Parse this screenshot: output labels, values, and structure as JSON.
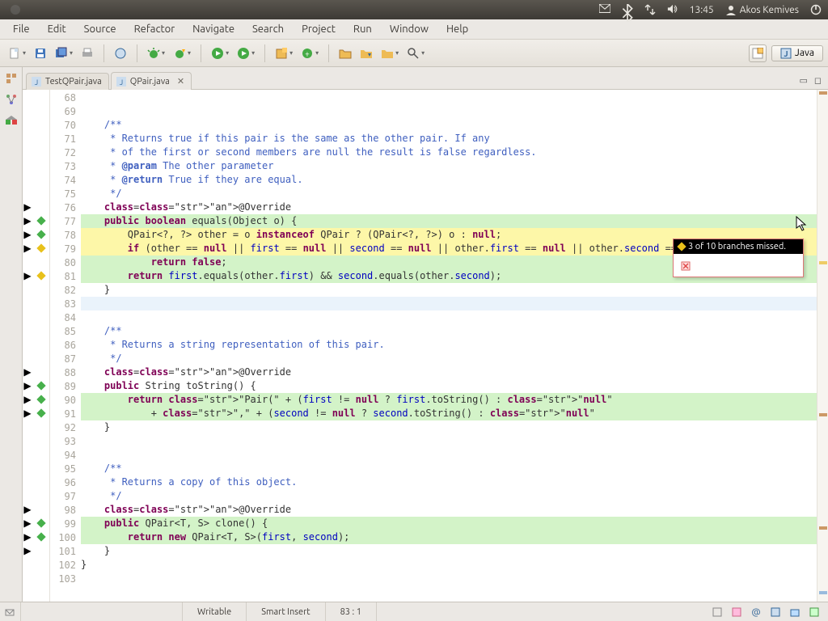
{
  "system": {
    "time": "13:45",
    "user": "Akos Kemives"
  },
  "menu": [
    "File",
    "Edit",
    "Source",
    "Refactor",
    "Navigate",
    "Search",
    "Project",
    "Run",
    "Window",
    "Help"
  ],
  "perspective": {
    "active": "Java"
  },
  "tabs": [
    {
      "label": "TestQPair.java",
      "active": false
    },
    {
      "label": "QPair.java",
      "active": true
    }
  ],
  "coverage_tooltip": "3 of 10 branches missed.",
  "status": {
    "mode": "Writable",
    "insert": "Smart Insert",
    "pos": "83 : 1"
  },
  "lines_start": 68,
  "lines_end": 103,
  "gutter_markers": {
    "76": "tri",
    "77": "tri",
    "78": "tri",
    "79": "tri",
    "81": "tri",
    "88": "tri",
    "89": "tri",
    "90": "tri",
    "91": "tri",
    "98": "tri",
    "99": "tri",
    "100": "tri",
    "101": "tri"
  },
  "coverage_markers": {
    "77": "green",
    "78": "green",
    "79": "yellow",
    "81": "yellow",
    "89": "green",
    "90": "green",
    "91": "green",
    "99": "green",
    "100": "green"
  },
  "highlight": {
    "77": "g",
    "78": "y",
    "79": "y",
    "80": "g",
    "81": "g",
    "90": "g",
    "91": "g",
    "99": "g",
    "100": "g"
  },
  "current_line": 83,
  "code": {
    "68": "",
    "69": "",
    "70": "    /**",
    "71": "     * Returns true if this pair is the same as the other pair. If any",
    "72": "     * of the first or second members are null the result is false regardless.",
    "73": "     * @param The other parameter",
    "74": "     * @return True if they are equal.",
    "75": "     */",
    "76": "    @Override",
    "77": "    public boolean equals(Object o) {",
    "78": "        QPair<?, ?> other = o instanceof QPair ? (QPair<?, ?>) o : null;",
    "79": "        if (other == null || first == null || second == null || other.first == null || other.second == null)",
    "80": "            return false;",
    "81": "        return first.equals(other.first) && second.equals(other.second);",
    "82": "    }",
    "83": "",
    "84": "",
    "85": "    /**",
    "86": "     * Returns a string representation of this pair.",
    "87": "     */",
    "88": "    @Override",
    "89": "    public String toString() {",
    "90": "        return \"Pair(\" + (first != null ? first.toString() : \"null\")",
    "91": "            + \",\" + (second != null ? second.toString() : \"null\") + \")\";",
    "92": "    }",
    "93": "",
    "94": "",
    "95": "    /**",
    "96": "     * Returns a copy of this object.",
    "97": "     */",
    "98": "    @Override",
    "99": "    public QPair<T, S> clone() {",
    "100": "        return new QPair<T, S>(first, second);",
    "101": "    }",
    "102": "}",
    "103": ""
  }
}
